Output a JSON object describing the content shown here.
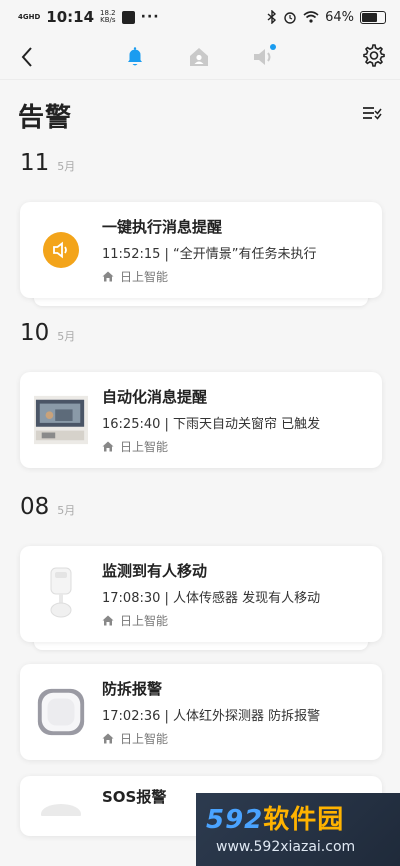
{
  "status_bar": {
    "network": "4GHD",
    "time": "10:14",
    "speed_value": "18.2",
    "speed_unit": "KB/s",
    "more": "···",
    "battery": "64%"
  },
  "nav": {
    "tabs": [
      {
        "icon": "bell-icon",
        "active": true
      },
      {
        "icon": "home-icon",
        "active": false
      },
      {
        "icon": "speaker-icon",
        "active": false
      }
    ],
    "accent": "#1a9cf0"
  },
  "page": {
    "title": "告警"
  },
  "groups": [
    {
      "day": "11",
      "month": "5月",
      "items": [
        {
          "icon": "speaker-circle-icon",
          "title": "一键执行消息提醒",
          "detail": "11:52:15 | “全开情景”有任务未执行",
          "home": "日上智能"
        }
      ]
    },
    {
      "day": "10",
      "month": "5月",
      "items": [
        {
          "icon": "tv-room-image",
          "title": "自动化消息提醒",
          "detail": "16:25:40 | 下雨天自动关窗帘 已触发",
          "home": "日上智能"
        }
      ]
    },
    {
      "day": "08",
      "month": "5月",
      "items": [
        {
          "icon": "motion-sensor-image",
          "title": "监测到有人移动",
          "detail": "17:08:30 | 人体传感器 发现有人移动",
          "home": "日上智能"
        },
        {
          "icon": "ir-detector-image",
          "title": "防拆报警",
          "detail": "17:02:36 | 人体红外探测器 防拆报警",
          "home": "日上智能"
        },
        {
          "icon": "sos-image",
          "title": "SOS报警",
          "detail": "",
          "home": ""
        }
      ]
    }
  ],
  "watermark": {
    "brand_num": "592",
    "brand_text": "软件园",
    "url": "www.592xiazai.com"
  }
}
